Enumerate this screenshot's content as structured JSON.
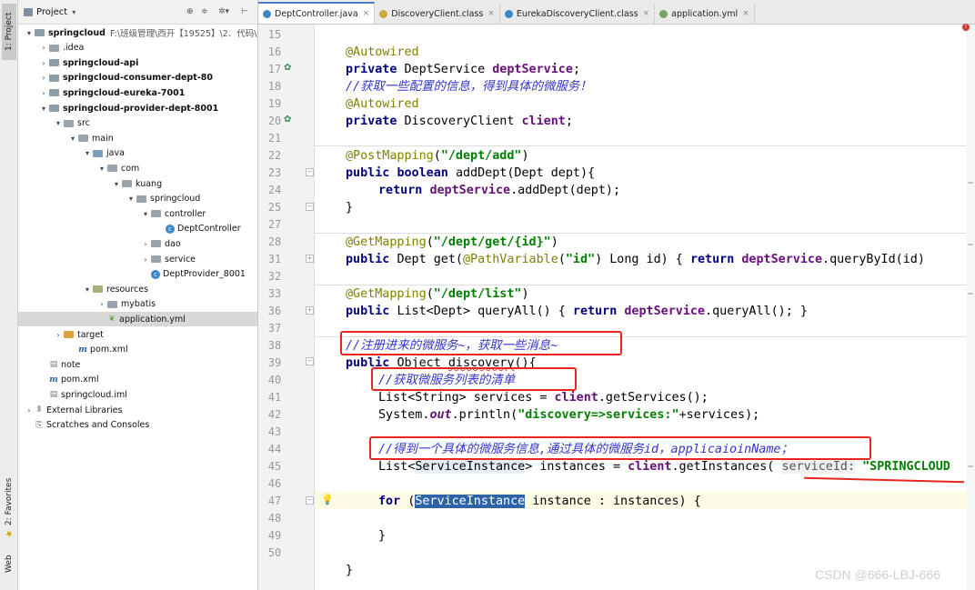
{
  "sidebar_tabs": {
    "project": "1: Project",
    "favorites": "2: Favorites",
    "web": "Web"
  },
  "project_panel": {
    "title": "Project",
    "tree": [
      {
        "label": "springcloud",
        "path": "F:\\班级管理\\西开【19525】\\2、代码\\sp",
        "kind": "module",
        "bold": true
      },
      {
        "label": ".idea",
        "kind": "folder"
      },
      {
        "label": "springcloud-api",
        "kind": "module",
        "bold": true
      },
      {
        "label": "springcloud-consumer-dept-80",
        "kind": "module",
        "bold": true
      },
      {
        "label": "springcloud-eureka-7001",
        "kind": "module",
        "bold": true
      },
      {
        "label": "springcloud-provider-dept-8001",
        "kind": "module",
        "bold": true
      },
      {
        "label": "src",
        "kind": "folder"
      },
      {
        "label": "main",
        "kind": "folder"
      },
      {
        "label": "java",
        "kind": "src"
      },
      {
        "label": "com",
        "kind": "package"
      },
      {
        "label": "kuang",
        "kind": "package"
      },
      {
        "label": "springcloud",
        "kind": "package"
      },
      {
        "label": "controller",
        "kind": "package"
      },
      {
        "label": "DeptController",
        "kind": "class"
      },
      {
        "label": "dao",
        "kind": "package"
      },
      {
        "label": "service",
        "kind": "package"
      },
      {
        "label": "DeptProvider_8001",
        "kind": "class"
      },
      {
        "label": "resources",
        "kind": "res"
      },
      {
        "label": "mybatis",
        "kind": "folder"
      },
      {
        "label": "application.yml",
        "kind": "yml"
      },
      {
        "label": "target",
        "kind": "target"
      },
      {
        "label": "pom.xml",
        "kind": "maven"
      },
      {
        "label": "note",
        "kind": "file"
      },
      {
        "label": "pom.xml",
        "kind": "maven"
      },
      {
        "label": "springcloud.iml",
        "kind": "file"
      },
      {
        "label": "External Libraries",
        "kind": "lib"
      },
      {
        "label": "Scratches and Consoles",
        "kind": "scratch"
      }
    ]
  },
  "tabs": [
    {
      "label": "DeptController.java",
      "active": true,
      "color": "#3d87c7"
    },
    {
      "label": "DiscoveryClient.class",
      "active": false,
      "color": "#c9a93a"
    },
    {
      "label": "EurekaDiscoveryClient.class",
      "active": false,
      "color": "#3d87c7"
    },
    {
      "label": "application.yml",
      "active": false,
      "color": "#79a35c"
    }
  ],
  "line_numbers": [
    "15",
    "16",
    "17",
    "18",
    "19",
    "20",
    "21",
    "22",
    "23",
    "24",
    "25",
    "27",
    "28",
    "31",
    "32",
    "33",
    "36",
    "37",
    "38",
    "39",
    "40",
    "41",
    "42",
    "43",
    "44",
    "45",
    "46",
    "47",
    "48",
    "49",
    "50"
  ],
  "code": {
    "autowired": "@Autowired",
    "private": "private",
    "dept_service_type": "DeptService",
    "dept_service_field": "deptService",
    "comment_config": "//获取一些配置的信息，得到具体的微服务！",
    "discovery_client_type": "DiscoveryClient",
    "client_field": "client",
    "post_mapping": "@PostMapping",
    "post_path": "\"/dept/add\"",
    "public": "public",
    "boolean": "boolean",
    "add_dept_sig": "addDept(Dept dept){",
    "return": "return",
    "add_dept_call": ".addDept(dept);",
    "close_brace": "}",
    "get_mapping": "@GetMapping",
    "get_path": "\"/dept/get/{id}\"",
    "get_sig_1": "Dept get(",
    "path_variable": "@PathVariable",
    "id_str": "\"id\"",
    "get_sig_2": ") Long id) { ",
    "query_by_id": ".queryById(id)",
    "list_path": "\"/dept/list\"",
    "list_sig": "List<Dept> queryAll() { ",
    "query_all": ".queryAll(); }",
    "comment_register": "//注册进来的微服务~，获取一些消息~",
    "discovery_sig_1": "Object ",
    "discovery_method": "discovery",
    "discovery_sig_2": "(){",
    "comment_list": "//获取微服务列表的清单",
    "services_1": "List<String> services = ",
    "services_2": ".getServices();",
    "println_1": "System.",
    "println_out": "out",
    "println_2": ".println(",
    "println_str": "\"discovery=>services:\"",
    "println_3": "+services);",
    "comment_instance": "//得到一个具体的微服务信息,通过具体的微服务id，applicaioinName；",
    "instances_1": "List<",
    "instances_type": "ServiceInstance",
    "instances_2": "> instances = ",
    "instances_3": ".getInstances(",
    "hint_service_id": "serviceId:",
    "instances_str": "\"SPRINGCLOUD",
    "for": "for",
    "for_paren": "(",
    "for_selected": "ServiceInstance",
    "for_rest": " instance : instances) {"
  },
  "watermark": "CSDN @666-LBJ-666"
}
